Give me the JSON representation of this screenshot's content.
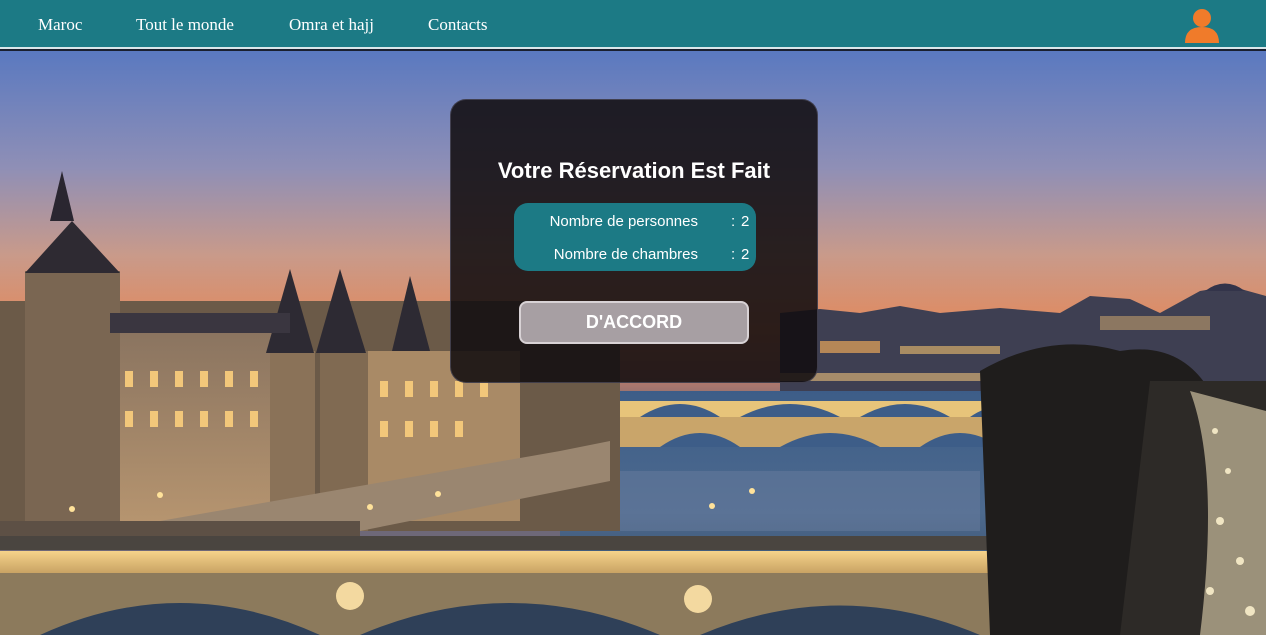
{
  "navbar": {
    "links": [
      {
        "label": "Maroc"
      },
      {
        "label": "Tout le monde"
      },
      {
        "label": "Omra et hajj"
      },
      {
        "label": "Contacts"
      }
    ],
    "user_icon": "user-icon",
    "background_color": "#1c7a85",
    "user_icon_color": "#f07b2a"
  },
  "modal": {
    "title": "Votre Réservation Est Fait",
    "details": [
      {
        "label": "Nombre de personnes",
        "separator": ":",
        "value": "2"
      },
      {
        "label": "Nombre de chambres",
        "separator": ":",
        "value": "2"
      }
    ],
    "confirm_label": "D'ACCORD",
    "info_box_color": "#1c7a85",
    "button_color": "#a79fa3"
  },
  "background": {
    "description_icon": "paris-seine-night-photo"
  }
}
